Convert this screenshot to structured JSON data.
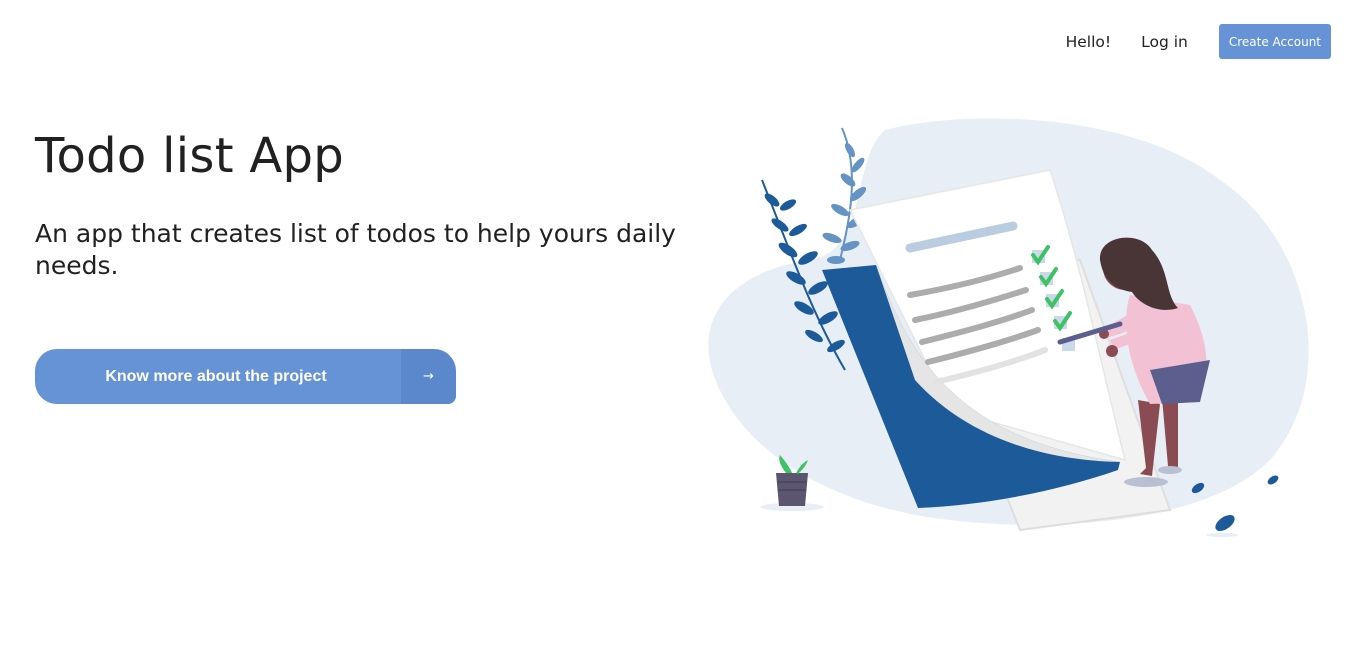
{
  "nav": {
    "greeting": "Hello!",
    "login_label": "Log in",
    "create_account_label": "Create Account"
  },
  "hero": {
    "title": "Todo list App",
    "subtitle": "An app that creates list of todos to help yours daily needs.",
    "cta_label": "Know more about the project",
    "cta_arrow": "→"
  },
  "colors": {
    "accent": "#6593d6",
    "accent_dark": "#5b87cd",
    "illustration_blue": "#1c5a99",
    "illustration_bg": "#e8eef5",
    "check_green": "#3ec364"
  },
  "illustration": {
    "icon": "todo-checklist-illustration"
  }
}
